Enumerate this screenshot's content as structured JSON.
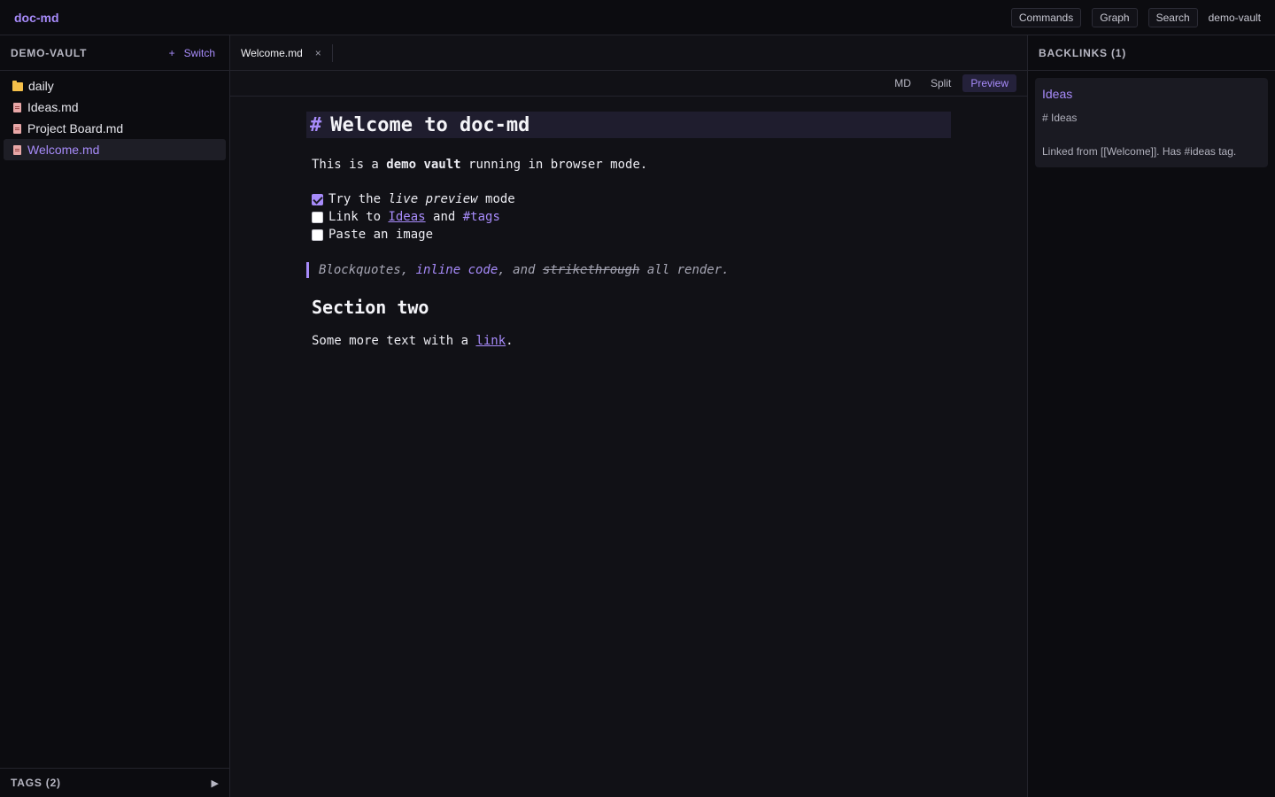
{
  "topbar": {
    "brand": "doc-md",
    "commands_label": "Commands",
    "graph_label": "Graph",
    "search_label": "Search",
    "vault": "demo-vault"
  },
  "sidebar": {
    "vault_title": "DEMO-VAULT",
    "switch_plus": "+",
    "switch_label": "Switch",
    "items": [
      {
        "label": "daily",
        "icon": "folder-icon"
      },
      {
        "label": "Ideas.md",
        "icon": "file-icon"
      },
      {
        "label": "Project Board.md",
        "icon": "file-icon"
      },
      {
        "label": "Welcome.md",
        "icon": "file-icon",
        "active": true
      }
    ],
    "tags_title": "TAGS (2)",
    "tags_toggle": "▶"
  },
  "tabs": [
    {
      "label": "Welcome.md",
      "close": "×"
    }
  ],
  "modes": {
    "md": "MD",
    "split": "Split",
    "preview": "Preview",
    "active": "Preview"
  },
  "doc": {
    "h1_hash": "#",
    "h1_text": "Welcome to doc-md",
    "p1": {
      "before": "This is a ",
      "bold": "demo vault",
      "after": " running in browser mode."
    },
    "task1": {
      "before": "Try the ",
      "italic": "live preview",
      "after": " mode",
      "checked": true
    },
    "task2": {
      "before": "Link to ",
      "link": "Ideas",
      "middle": " and ",
      "tag": "#tags",
      "checked": false
    },
    "task3": {
      "text": "Paste an image",
      "checked": false
    },
    "quote": {
      "part1": "Blockquotes, ",
      "code": "inline code",
      "part2": ", and ",
      "strike": "strikethrough",
      "part3": " all render."
    },
    "h2": "Section two",
    "p2": {
      "before": "Some more text with a ",
      "link": "link",
      "after": "."
    }
  },
  "backlinks": {
    "title": "BACKLINKS (1)",
    "items": [
      {
        "title": "Ideas",
        "heading": "# Ideas",
        "snippet": "Linked from [[Welcome]]. Has #ideas tag."
      }
    ]
  },
  "colors": {
    "accent": "#a78bfa",
    "folder": "#f5c04a",
    "background": "#111116",
    "panel": "#0c0c10"
  }
}
